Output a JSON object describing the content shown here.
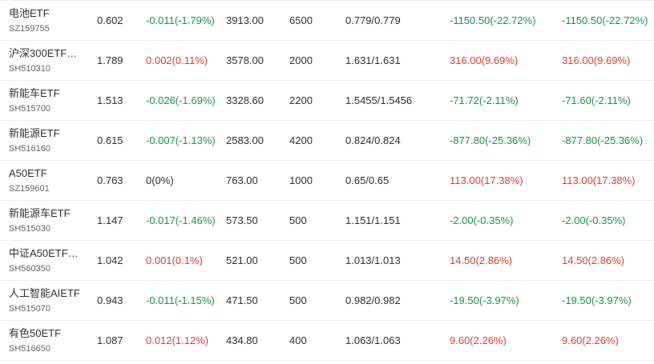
{
  "colors": {
    "up": "#e2403a",
    "down": "#1a9945",
    "flat": "#333333"
  },
  "rows": [
    {
      "name": "电池ETF",
      "code": "SZ159755",
      "price": "0.602",
      "change": "-0.011(-1.79%)",
      "change_dir": "down",
      "market_value": "3913.00",
      "quantity": "6500",
      "cost": "0.779/0.779",
      "pl_a": "-1150.50(-22.72%)",
      "pl_a_dir": "down",
      "pl_b": "-1150.50(-22.72%)",
      "pl_b_dir": "down"
    },
    {
      "name": "沪深300ETF…",
      "code": "SH510310",
      "price": "1.789",
      "change": "0.002(0.11%)",
      "change_dir": "up",
      "market_value": "3578.00",
      "quantity": "2000",
      "cost": "1.631/1.631",
      "pl_a": "316.00(9.69%)",
      "pl_a_dir": "up",
      "pl_b": "316.00(9.69%)",
      "pl_b_dir": "up"
    },
    {
      "name": "新能车ETF",
      "code": "SH515700",
      "price": "1.513",
      "change": "-0.026(-1.69%)",
      "change_dir": "down",
      "market_value": "3328.60",
      "quantity": "2200",
      "cost": "1.5455/1.5456",
      "pl_a": "-71.72(-2.11%)",
      "pl_a_dir": "down",
      "pl_b": "-71.60(-2.11%)",
      "pl_b_dir": "down"
    },
    {
      "name": "新能源ETF",
      "code": "SH516160",
      "price": "0.615",
      "change": "-0.007(-1.13%)",
      "change_dir": "down",
      "market_value": "2583.00",
      "quantity": "4200",
      "cost": "0.824/0.824",
      "pl_a": "-877.80(-25.36%)",
      "pl_a_dir": "down",
      "pl_b": "-877.80(-25.36%)",
      "pl_b_dir": "down"
    },
    {
      "name": "A50ETF",
      "code": "SZ159601",
      "price": "0.763",
      "change": "0(0%)",
      "change_dir": "flat",
      "market_value": "763.00",
      "quantity": "1000",
      "cost": "0.65/0.65",
      "pl_a": "113.00(17.38%)",
      "pl_a_dir": "up",
      "pl_b": "113.00(17.38%)",
      "pl_b_dir": "up"
    },
    {
      "name": "新能源车ETF",
      "code": "SH515030",
      "price": "1.147",
      "change": "-0.017(-1.46%)",
      "change_dir": "down",
      "market_value": "573.50",
      "quantity": "500",
      "cost": "1.151/1.151",
      "pl_a": "-2.00(-0.35%)",
      "pl_a_dir": "down",
      "pl_b": "-2.00(-0.35%)",
      "pl_b_dir": "down"
    },
    {
      "name": "中证A50ETF…",
      "code": "SH560350",
      "price": "1.042",
      "change": "0.001(0.1%)",
      "change_dir": "up",
      "market_value": "521.00",
      "quantity": "500",
      "cost": "1.013/1.013",
      "pl_a": "14.50(2.86%)",
      "pl_a_dir": "up",
      "pl_b": "14.50(2.86%)",
      "pl_b_dir": "up"
    },
    {
      "name": "人工智能AIETF",
      "code": "SH515070",
      "price": "0.943",
      "change": "-0.011(-1.15%)",
      "change_dir": "down",
      "market_value": "471.50",
      "quantity": "500",
      "cost": "0.982/0.982",
      "pl_a": "-19.50(-3.97%)",
      "pl_a_dir": "down",
      "pl_b": "-19.50(-3.97%)",
      "pl_b_dir": "down"
    },
    {
      "name": "有色50ETF",
      "code": "SH516650",
      "price": "1.087",
      "change": "0.012(1.12%)",
      "change_dir": "up",
      "market_value": "434.80",
      "quantity": "400",
      "cost": "1.063/1.063",
      "pl_a": "9.60(2.26%)",
      "pl_a_dir": "up",
      "pl_b": "9.60(2.26%)",
      "pl_b_dir": "up"
    }
  ]
}
